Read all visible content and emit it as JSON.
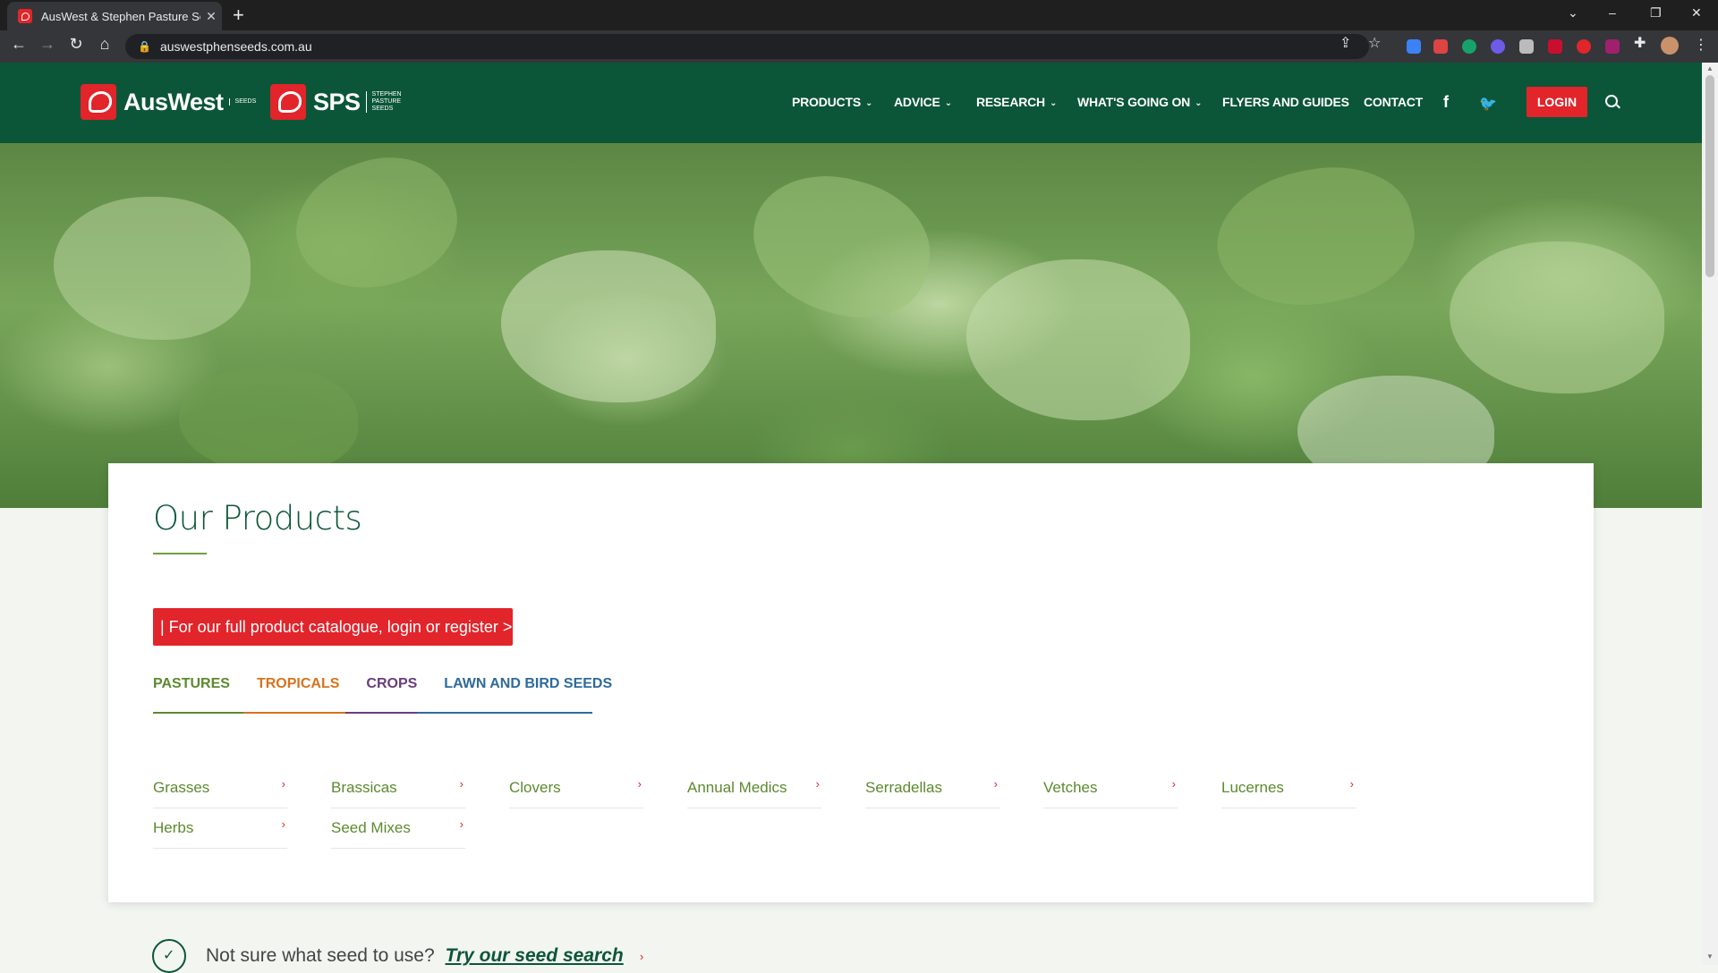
{
  "browser": {
    "tab_title": "AusWest & Stephen Pasture Seed",
    "tab_close": "✕",
    "new_tab": "+",
    "url": "auswestphenseeds.com.au",
    "window_controls": [
      "⌄",
      "–",
      "❐",
      "✕"
    ]
  },
  "header": {
    "brand1": {
      "name": "AusWest",
      "sub": "SEEDS"
    },
    "brand2": {
      "name": "SPS",
      "sub": "STEPHEN PASTURE SEEDS"
    },
    "nav": [
      {
        "label": "PRODUCTS",
        "dropdown": true
      },
      {
        "label": "ADVICE",
        "dropdown": true
      },
      {
        "label": "RESEARCH",
        "dropdown": true
      },
      {
        "label": "WHAT'S GOING ON",
        "dropdown": true
      },
      {
        "label": "FLYERS AND GUIDES",
        "dropdown": false
      },
      {
        "label": "CONTACT",
        "dropdown": false
      }
    ],
    "social": {
      "facebook": "f",
      "twitter": "🐦"
    },
    "login_label": "LOGIN"
  },
  "products": {
    "title": "Our Products",
    "cta": "| For our full product catalogue, login or register >",
    "tabs": [
      {
        "label": "PASTURES",
        "color": "#5c8a2f"
      },
      {
        "label": "TROPICALS",
        "color": "#d6731f"
      },
      {
        "label": "CROPS",
        "color": "#6b3d7a"
      },
      {
        "label": "LAWN AND BIRD SEEDS",
        "color": "#2f6b9a"
      }
    ],
    "categories": [
      {
        "label": "Grasses"
      },
      {
        "label": "Brassicas"
      },
      {
        "label": "Clovers"
      },
      {
        "label": "Annual Medics"
      },
      {
        "label": "Serradellas"
      },
      {
        "label": "Vetches"
      },
      {
        "label": "Lucernes"
      },
      {
        "label": "Herbs"
      },
      {
        "label": "Seed Mixes"
      }
    ],
    "chevron": "›"
  },
  "seed_search": {
    "text": "Not sure what seed to use?",
    "link": "Try our seed search",
    "arrow": "›"
  },
  "colors": {
    "brand_green": "#0b5638",
    "brand_red": "#e2242b",
    "category_green": "#5c8a2f"
  }
}
